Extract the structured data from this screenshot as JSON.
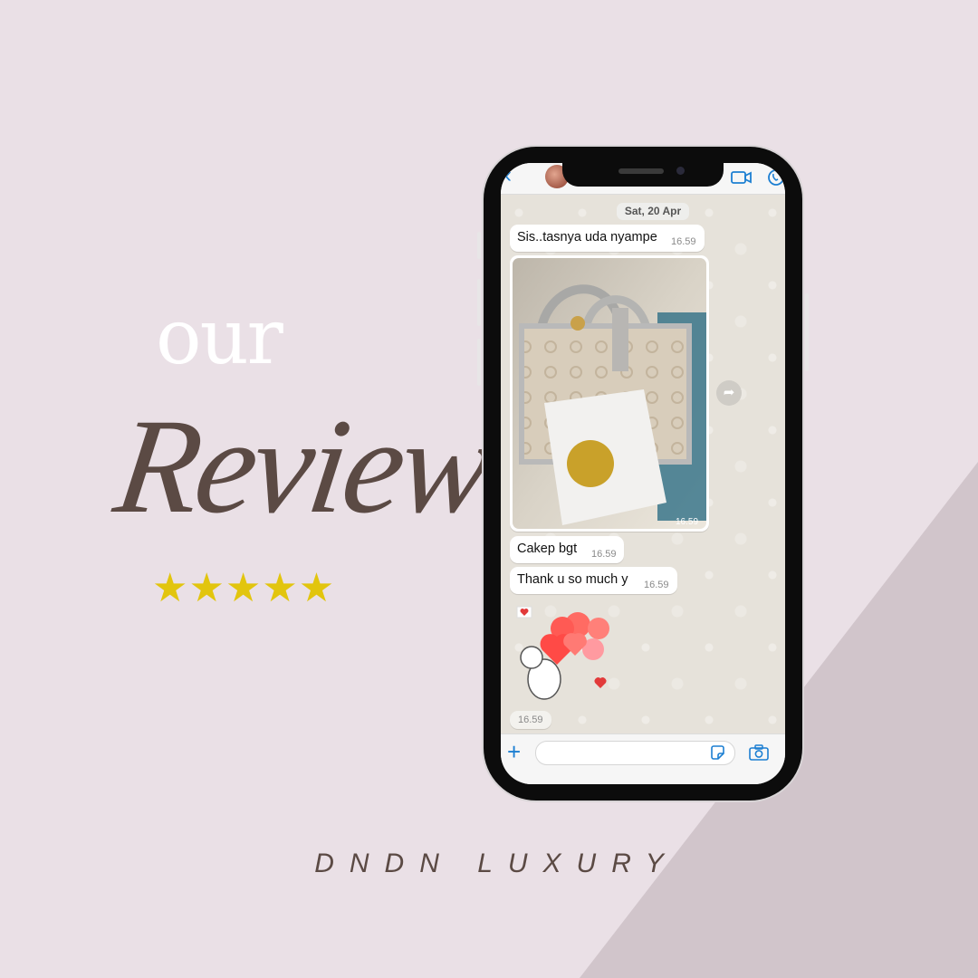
{
  "poster": {
    "heading_small": "our",
    "heading_script": "Review",
    "rating_stars": "★★★★★",
    "rating_value": 5,
    "brand": "DNDN LUXURY",
    "colors": {
      "background": "#eae0e6",
      "diagonal": "#d1c5cb",
      "script_text": "#5b4a44",
      "stars": "#e2c50e"
    }
  },
  "chat": {
    "header": {
      "back_icon": "chevron-left-icon",
      "video_icon": "video-call-icon",
      "call_icon": "phone-call-icon"
    },
    "date_separator": "Sat, 20 Apr",
    "messages": [
      {
        "text": "Sis..tasnya uda nyampe",
        "time": "16.59"
      },
      {
        "type": "photo",
        "time": "16.59"
      },
      {
        "text": "Cakep bgt",
        "time": "16.59"
      },
      {
        "text": "Thank u so much y",
        "time": "16.59"
      },
      {
        "type": "sticker",
        "time": "16.59"
      }
    ],
    "input": {
      "placeholder": "",
      "plus_icon": "plus-icon",
      "sticker_icon": "sticker-icon",
      "camera_icon": "camera-icon"
    },
    "colors": {
      "accent": "#1c7fd2",
      "bubble": "#ffffff",
      "wallpaper": "#e6e2da"
    }
  }
}
